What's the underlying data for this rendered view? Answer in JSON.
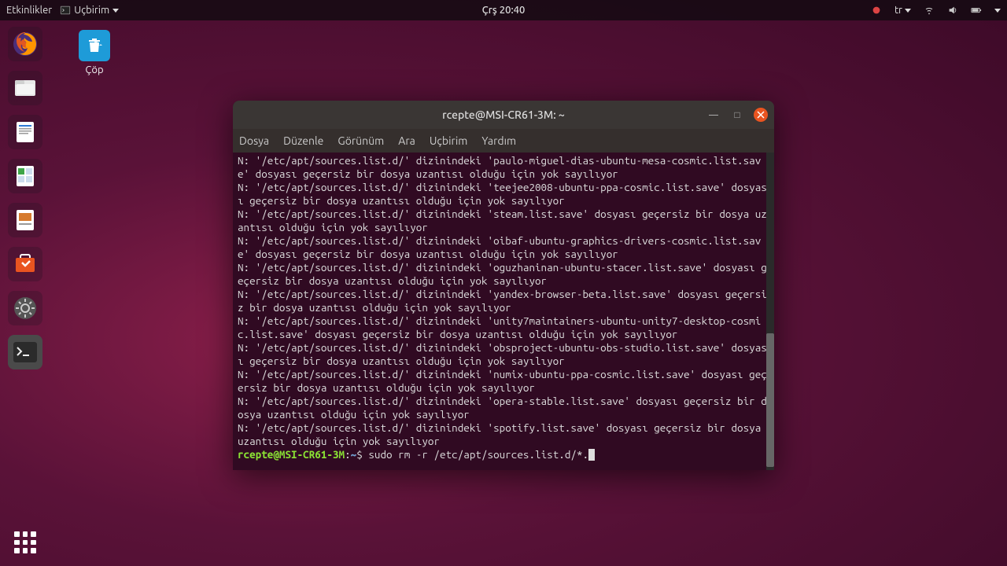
{
  "topbar": {
    "activities": "Etkinlikler",
    "app_name": "Uçbirim",
    "clock": "Çrş 20:40",
    "lang": "tr"
  },
  "desktop": {
    "trash_label": "Çöp"
  },
  "terminal": {
    "title": "rcepte@MSI-CR61-3M: ~",
    "menu": [
      "Dosya",
      "Düzenle",
      "Görünüm",
      "Ara",
      "Uçbirim",
      "Yardım"
    ],
    "lines": [
      "N: '/etc/apt/sources.list.d/' dizinindeki 'paulo-miguel-dias-ubuntu-mesa-cosmic.list.save' dosyası geçersiz bir dosya uzantısı olduğu için yok sayılıyor",
      "N: '/etc/apt/sources.list.d/' dizinindeki 'teejee2008-ubuntu-ppa-cosmic.list.save' dosyası geçersiz bir dosya uzantısı olduğu için yok sayılıyor",
      "N: '/etc/apt/sources.list.d/' dizinindeki 'steam.list.save' dosyası geçersiz bir dosya uzantısı olduğu için yok sayılıyor",
      "N: '/etc/apt/sources.list.d/' dizinindeki 'oibaf-ubuntu-graphics-drivers-cosmic.list.save' dosyası geçersiz bir dosya uzantısı olduğu için yok sayılıyor",
      "N: '/etc/apt/sources.list.d/' dizinindeki 'oguzhaninan-ubuntu-stacer.list.save' dosyası geçersiz bir dosya uzantısı olduğu için yok sayılıyor",
      "N: '/etc/apt/sources.list.d/' dizinindeki 'yandex-browser-beta.list.save' dosyası geçersiz bir dosya uzantısı olduğu için yok sayılıyor",
      "N: '/etc/apt/sources.list.d/' dizinindeki 'unity7maintainers-ubuntu-unity7-desktop-cosmic.list.save' dosyası geçersiz bir dosya uzantısı olduğu için yok sayılıyor",
      "N: '/etc/apt/sources.list.d/' dizinindeki 'obsproject-ubuntu-obs-studio.list.save' dosyası geçersiz bir dosya uzantısı olduğu için yok sayılıyor",
      "N: '/etc/apt/sources.list.d/' dizinindeki 'numix-ubuntu-ppa-cosmic.list.save' dosyası geçersiz bir dosya uzantısı olduğu için yok sayılıyor",
      "N: '/etc/apt/sources.list.d/' dizinindeki 'opera-stable.list.save' dosyası geçersiz bir dosya uzantısı olduğu için yok sayılıyor",
      "N: '/etc/apt/sources.list.d/' dizinindeki 'spotify.list.save' dosyası geçersiz bir dosya uzantısı olduğu için yok sayılıyor"
    ],
    "prompt_user": "rcepte@MSI-CR61-3M",
    "prompt_path": "~",
    "command": "sudo rm -r /etc/apt/sources.list.d/*."
  }
}
